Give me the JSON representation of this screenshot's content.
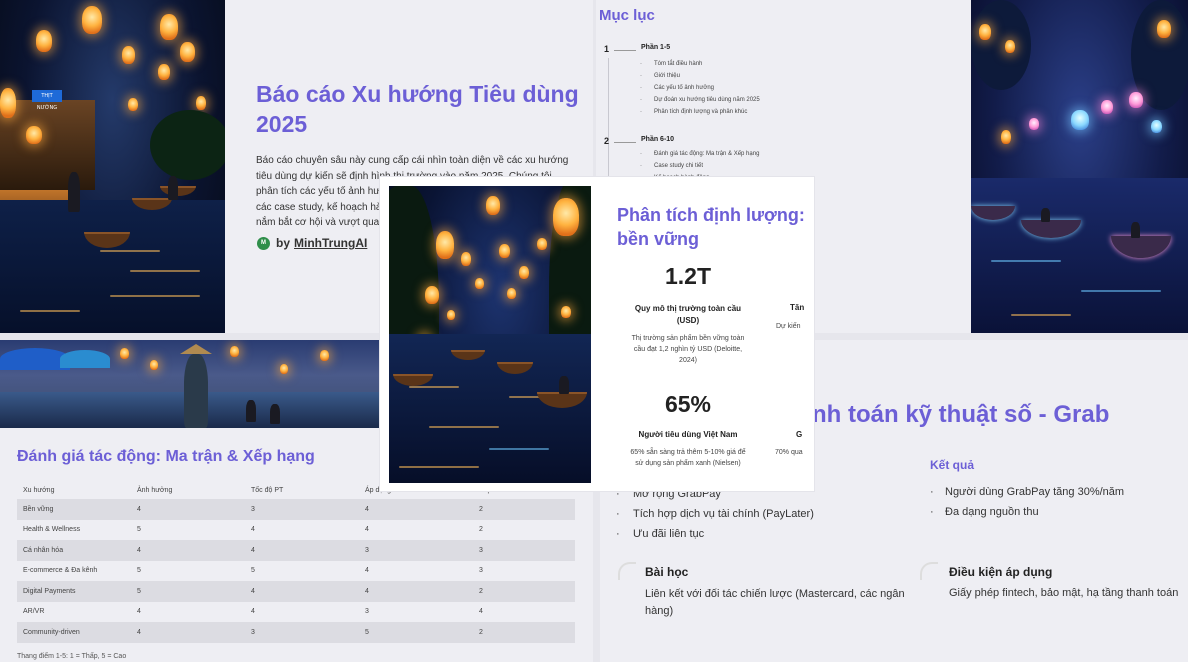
{
  "report": {
    "title_line1": "Báo cáo Xu hướng Tiêu dùng",
    "title_line2": "2025",
    "body_lines": [
      "Báo cáo chuyên sâu này cung cấp cái nhìn toàn diện về các xu hướng",
      "tiêu dùng dự kiến sẽ định hình thị trường vào năm 2025. Chúng tôi",
      "phân tích các yếu tố ảnh hư",
      "các case study, kế hoạch hà",
      "nắm bắt cơ hội và vượt qua"
    ],
    "author_prefix": "by",
    "author_name": "MinhTrungAI",
    "avatar_initials": "M",
    "stall_sign": "THỊT NƯỚNG"
  },
  "toc": {
    "title": "Mục lục",
    "sections": [
      {
        "num": "1",
        "title": "Phần 1-5",
        "items": [
          "Tóm tắt điều hành",
          "Giới thiệu",
          "Các yếu tố ảnh hưởng",
          "Dự đoán xu hướng tiêu dùng năm 2025",
          "Phân tích định lượng và phân khúc"
        ]
      },
      {
        "num": "2",
        "title": "Phần 6-10",
        "items": [
          "Đánh giá tác động: Ma trận & Xếp hạng",
          "Case study chi tiết",
          "Kế hoạch hành động"
        ]
      }
    ]
  },
  "quant": {
    "title_line1": "Phân tích định lượng:",
    "title_line2": "bền vững",
    "stats": [
      {
        "value": "1.2T",
        "label_line1": "Quy mô thị trường toàn cầu",
        "label_line2": "(USD)",
        "desc": [
          "Thị trường sản phẩm bền vững toàn",
          "cầu đạt 1,2 nghìn tỷ USD (Deloitte,",
          "2024)"
        ]
      },
      {
        "value": "65%",
        "label_line1": "Người tiêu dùng Việt Nam",
        "label_line2": "",
        "desc": [
          "65% sẵn sàng trả thêm 5-10% giá để",
          "sử dụng sản phẩm xanh (Nielsen)"
        ]
      }
    ],
    "peek_labels": [
      "Tăn",
      "Dự kiến",
      "G",
      "70% qua"
    ]
  },
  "matrix": {
    "title": "Đánh giá tác động: Ma trận & Xếp hạng",
    "headers": [
      "Xu hướng",
      "Ảnh hưởng",
      "Tốc độ PT",
      "Áp dụng",
      "Xếp h"
    ],
    "rows": [
      [
        "Bền vững",
        "4",
        "3",
        "4",
        "2"
      ],
      [
        "Health & Wellness",
        "5",
        "4",
        "4",
        "2"
      ],
      [
        "Cá nhân hóa",
        "4",
        "4",
        "3",
        "3"
      ],
      [
        "E-commerce & Đa kênh",
        "5",
        "5",
        "4",
        "3"
      ],
      [
        "Digital Payments",
        "5",
        "4",
        "4",
        "2"
      ],
      [
        "AR/VR",
        "4",
        "4",
        "3",
        "4"
      ],
      [
        "Community-driven",
        "4",
        "3",
        "5",
        "2"
      ]
    ],
    "footnote": "Thang điểm 1-5: 1 = Thấp, 5 = Cao"
  },
  "grab": {
    "title": "nh toán kỹ thuật số - Grab",
    "left_items": [
      "Mở rộng GrabPay",
      "Tích hợp dịch vụ tài chính (PayLater)",
      "Ưu đãi liên tục"
    ],
    "result_heading": "Kết quả",
    "results": [
      "Người dùng GrabPay tăng 30%/năm",
      "Đa dạng nguồn thu"
    ],
    "lesson_title": "Bài học",
    "lesson_lines": [
      "Liên kết với đối tác chiến lược (Mastercard, các ngân",
      "hàng)"
    ],
    "condition_title": "Điều kiện áp dụng",
    "condition_text": "Giấy phép fintech, bảo mật, hạ tầng thanh toán"
  },
  "colors": {
    "accent": "#6c5fd6",
    "text": "#333333",
    "table_stripe": "#dcdce2"
  }
}
